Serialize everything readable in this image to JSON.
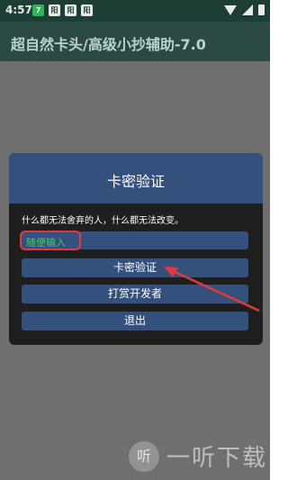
{
  "status_bar": {
    "time": "4:57",
    "notif_icons": [
      "7",
      "阳",
      "阳",
      "阳"
    ]
  },
  "app_bar": {
    "title": "超自然卡头/高级小抄辅助-7.0"
  },
  "dialog": {
    "title": "卡密验证",
    "message": "什么都无法舍弃的人，什么都无法改变。",
    "input": {
      "value": "随便输入"
    },
    "buttons": {
      "verify": "卡密验证",
      "tip": "打赏开发者",
      "exit": "退出"
    }
  },
  "watermark": {
    "logo_text": "听",
    "text": "一听下载"
  },
  "colors": {
    "status_bar": "#1d3f33",
    "app_bar": "#2b4a41",
    "overlay": "#6f6f6f",
    "dialog_bg": "#1e1e1e",
    "dialog_accent": "#34517e",
    "input_text": "#3bcf63",
    "annotation_red": "#e03a3a"
  }
}
